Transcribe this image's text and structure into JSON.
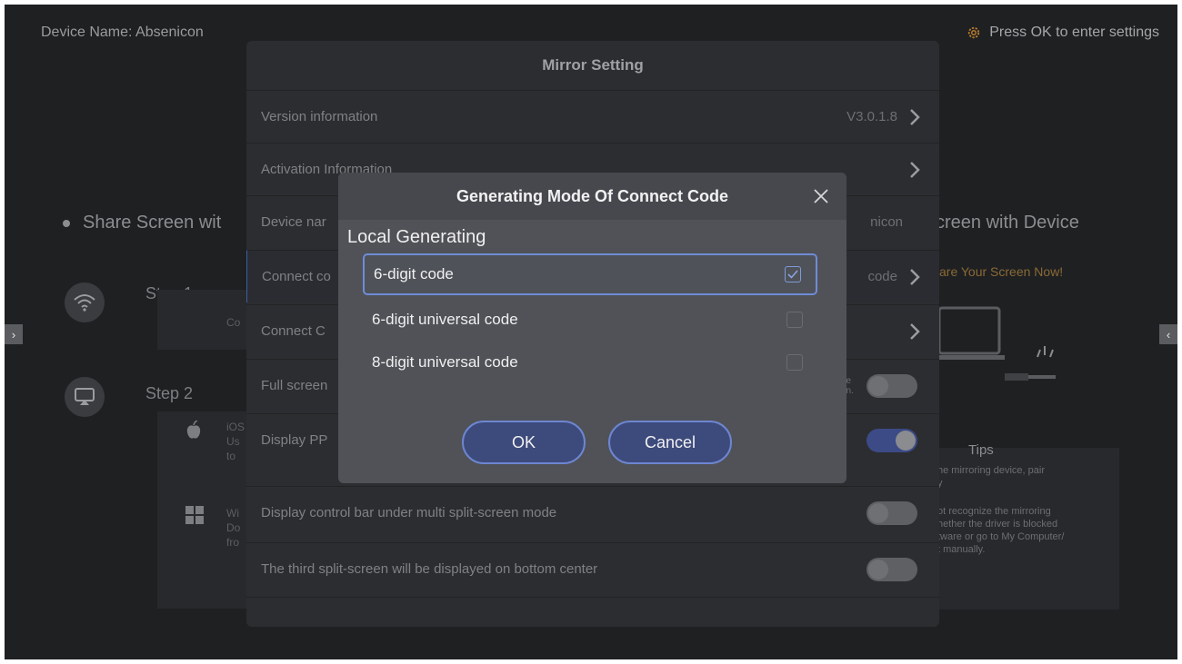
{
  "background": {
    "device_name": "Device Name: Absenicon",
    "settings_hint": "Press OK to enter settings",
    "share_left": "Share Screen wit",
    "share_right": "creen with Device",
    "share_now": "are Your Screen Now!",
    "step1": "Step  1",
    "step2": "Step  2",
    "step1_sub": "Co",
    "ios_label": "iOS",
    "ios_desc_1": "Us",
    "ios_desc_2": "to",
    "win_label": "Wi",
    "win_desc_1": "Do",
    "win_desc_2": "fro",
    "tips_title": "Tips",
    "tips_line1": "he mirroring device, pair",
    "tips_line2": "y",
    "tips_line3": "ot recognize the mirroring",
    "tips_line4": "hether the driver is blocked",
    "tips_line5": "tware or go to My Computer/",
    "tips_line6": "t manually.",
    "left_arrow": "›",
    "right_arrow": "‹"
  },
  "mirror_setting": {
    "title": "Mirror Setting",
    "rows": [
      {
        "label": "Version information",
        "value": "V3.0.1.8"
      },
      {
        "label": "Activation Information",
        "value": ""
      },
      {
        "label": "Device nar",
        "value": "nicon"
      },
      {
        "label": "Connect co",
        "value": "code"
      },
      {
        "label": "Connect C",
        "value": ""
      },
      {
        "label": "Full screen",
        "value": "he en."
      },
      {
        "label": "Display PP",
        "value": ""
      },
      {
        "label": "Display control bar under multi split-screen mode",
        "value": ""
      },
      {
        "label": "The third split-screen will be displayed on bottom center",
        "value": ""
      }
    ],
    "toggles": {
      "full_screen": false,
      "display_ppt": true,
      "control_bar": false,
      "third_split": false,
      "last_row": true
    }
  },
  "dialog": {
    "title": "Generating Mode Of Connect Code",
    "section": "Local Generating",
    "options": [
      {
        "label": "6-digit code",
        "checked": true
      },
      {
        "label": "6-digit universal code",
        "checked": false
      },
      {
        "label": "8-digit universal code",
        "checked": false
      }
    ],
    "ok_label": "OK",
    "cancel_label": "Cancel"
  },
  "colors": {
    "screen_bg": "#1f2022",
    "panel_bg": "#2c2d30",
    "dialog_bg": "#505258",
    "accent": "#6d86d1",
    "toggle_on": "#3c4a86",
    "orange_hint": "#8a6a36"
  }
}
